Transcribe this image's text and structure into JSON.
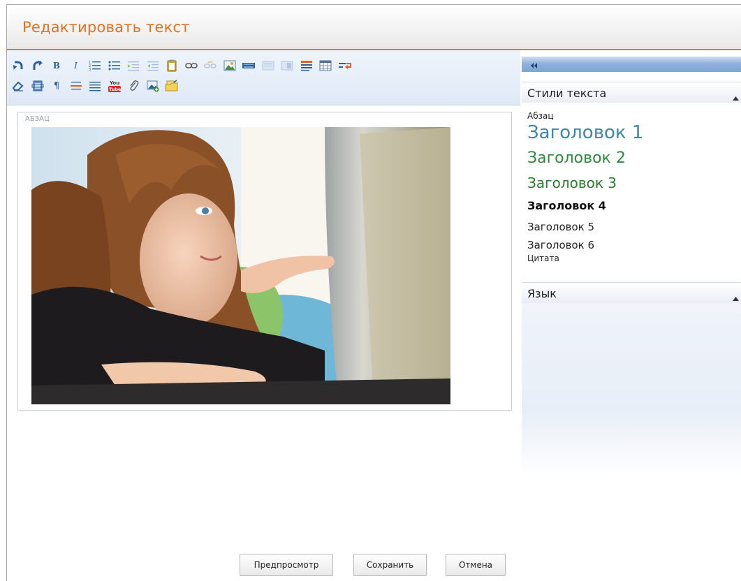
{
  "window": {
    "title": "Редактировать текст"
  },
  "toolbar": {
    "row1": [
      "undo-icon",
      "redo-icon",
      "bold-icon",
      "italic-icon",
      "ordered-list-icon",
      "unordered-list-icon",
      "indent-icon",
      "outdent-icon",
      "paste-icon",
      "link-icon",
      "unlink-icon",
      "image-icon",
      "media-icon",
      "align-left-icon",
      "align-right-icon",
      "format-icon",
      "table-icon",
      "wrap-icon"
    ],
    "row2": [
      "eraser-icon",
      "template-icon",
      "paragraph-icon",
      "horizontal-rule-icon",
      "justify-icon",
      "youtube-icon",
      "attachment-icon",
      "insert-image-icon",
      "folder-icon"
    ],
    "youtube_text_top": "You",
    "youtube_text_bottom": "Tube",
    "bold_glyph": "B",
    "italic_glyph": "I",
    "paragraph_glyph": "¶"
  },
  "editor": {
    "block_label": "АБЗАЦ",
    "image_description_icon": "photo-girl-laptop"
  },
  "side_panel": {
    "collapse_glyph": "◂◂",
    "styles_header": "Стили текста",
    "styles": [
      {
        "label": "Абзац",
        "name": "style-paragraph"
      },
      {
        "label": "Заголовок 1",
        "name": "style-h1"
      },
      {
        "label": "Заголовок 2",
        "name": "style-h2"
      },
      {
        "label": "Заголовок 3",
        "name": "style-h3"
      },
      {
        "label": "Заголовок 4",
        "name": "style-h4"
      },
      {
        "label": "Заголовок 5",
        "name": "style-h5"
      },
      {
        "label": "Заголовок 6",
        "name": "style-h6"
      },
      {
        "label": "Цитата",
        "name": "style-quote"
      }
    ],
    "language_header": "Язык"
  },
  "buttons": {
    "preview": "Предпросмотр",
    "save": "Сохранить",
    "cancel": "Отмена"
  },
  "colors": {
    "accent": "#e27221",
    "h1": "#3f87a6",
    "h2": "#2f8a3a",
    "h3": "#2b7a2f",
    "toolbar_blue": "#2d5f9a"
  }
}
